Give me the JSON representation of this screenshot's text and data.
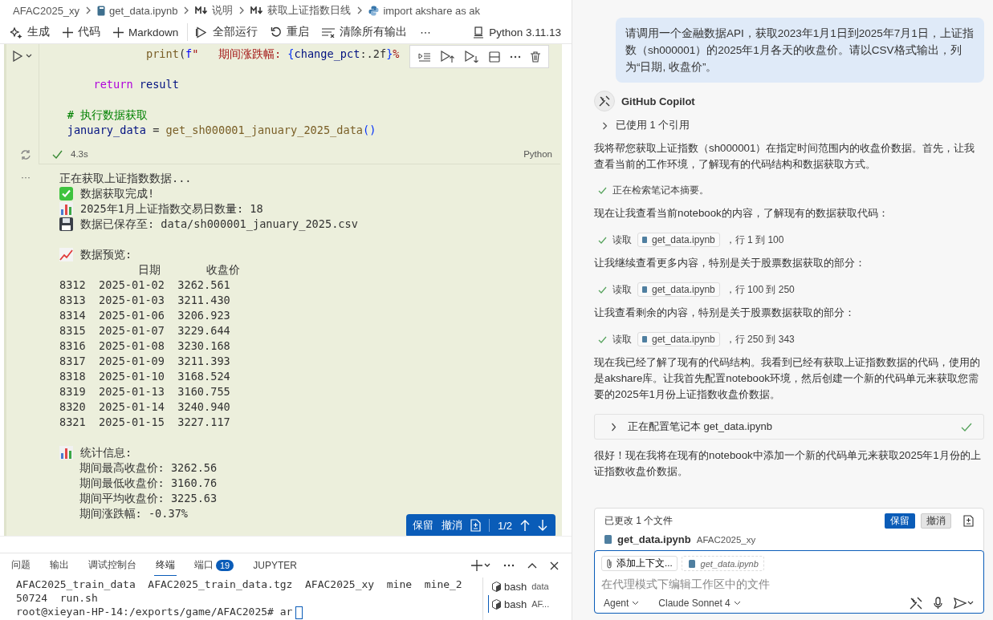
{
  "breadcrumb": [
    {
      "kind": "folder",
      "label": "AFAC2025_xy"
    },
    {
      "kind": "notebook",
      "label": "get_data.ipynb"
    },
    {
      "kind": "markdown",
      "label": "说明"
    },
    {
      "kind": "markdown",
      "label": "获取上证指数日线"
    },
    {
      "kind": "python",
      "label": "import akshare as ak"
    }
  ],
  "toolbar": [
    {
      "kind": "sparkle",
      "label": "生成"
    },
    {
      "kind": "plus",
      "label": "代码"
    },
    {
      "kind": "plus",
      "label": "Markdown"
    },
    {
      "kind": "run-all",
      "label": "全部运行"
    },
    {
      "kind": "restart",
      "label": "重启"
    },
    {
      "kind": "clear",
      "label": "清除所有输出"
    },
    {
      "kind": "more",
      "label": "⋯"
    }
  ],
  "kernel": "Python 3.11.13",
  "code_lines": [
    {
      "space_before": false,
      "tokens": [
        {
          "kind": "fn",
          "text": "                print"
        },
        {
          "kind": "punc",
          "text": "("
        },
        {
          "kind": "kw2",
          "text": "f"
        },
        {
          "kind": "str",
          "text": "\"   期间涨跌幅: "
        },
        {
          "kind": "punc2",
          "text": "{"
        },
        {
          "kind": "var",
          "text": "change_pct"
        },
        {
          "kind": "plain",
          "text": ":.2f"
        },
        {
          "kind": "punc2",
          "text": "}"
        },
        {
          "kind": "str",
          "text": "%"
        }
      ]
    },
    {
      "space_before": true,
      "tokens": [
        {
          "kind": "kw",
          "text": "        return"
        },
        {
          "kind": "var",
          "text": " result"
        }
      ]
    },
    {
      "space_before": true,
      "tokens": [
        {
          "kind": "comment",
          "text": "    # 执行数据获取"
        }
      ]
    },
    {
      "space_before": false,
      "tokens": [
        {
          "kind": "var",
          "text": "    january_data"
        },
        {
          "kind": "plain",
          "text": " = "
        },
        {
          "kind": "fn",
          "text": "get_sh000001_january_2025_data"
        },
        {
          "kind": "punc2",
          "text": "()"
        }
      ]
    }
  ],
  "cell": {
    "duration": "4.3s",
    "language": "Python",
    "succeeded": true
  },
  "output_ellipsis": "···",
  "output_lines": [
    {
      "text": "正在获取上证指数数据..."
    },
    {
      "kind": "check",
      "text": "数据获取完成!"
    },
    {
      "kind": "bars",
      "text": "2025年1月上证指数交易日数量: 18"
    },
    {
      "kind": "disk",
      "text": "数据已保存至: data/sh000001_january_2025.csv"
    },
    {
      "kind": "trend",
      "text": "数据预览:",
      "space_before": true
    },
    {
      "text": "            日期       收盘价"
    },
    {
      "text": "8312  2025-01-02  3262.561"
    },
    {
      "text": "8313  2025-01-03  3211.430"
    },
    {
      "text": "8314  2025-01-06  3206.923"
    },
    {
      "text": "8315  2025-01-07  3229.644"
    },
    {
      "text": "8316  2025-01-08  3230.168"
    },
    {
      "text": "8317  2025-01-09  3211.393"
    },
    {
      "text": "8318  2025-01-10  3168.524"
    },
    {
      "text": "8319  2025-01-13  3160.755"
    },
    {
      "text": "8320  2025-01-14  3240.940"
    },
    {
      "text": "8321  2025-01-15  3227.117"
    },
    {
      "kind": "bars",
      "text": "统计信息:",
      "space_before": true
    },
    {
      "text": "   期间最高收盘价: 3262.56"
    },
    {
      "text": "   期间最低收盘价: 3160.76"
    },
    {
      "text": "   期间平均收盘价: 3225.63"
    },
    {
      "text": "   期间涨跌幅: -0.37%"
    }
  ],
  "diff_widget": {
    "keep": "保留",
    "undo": "撤消",
    "position": "1/2"
  },
  "panel": {
    "tabs": [
      {
        "label": "问题",
        "selected": false
      },
      {
        "label": "输出",
        "selected": false
      },
      {
        "label": "调试控制台",
        "selected": false
      },
      {
        "label": "终端",
        "selected": true
      },
      {
        "label": "端口",
        "badge": "19",
        "selected": false
      },
      {
        "label": "JUPYTER",
        "selected": false
      }
    ],
    "terminal_lines": [
      "AFAC2025_train_data  AFAC2025_train_data.tgz  AFAC2025_xy  mine  mine_2",
      "50724  run.sh",
      "root@xieyan-HP-14:/exports/game/AFAC2025# ar"
    ],
    "terminals": [
      {
        "name": "bash",
        "detail": "data",
        "selected": false
      },
      {
        "name": "bash",
        "detail": "AF...",
        "selected": true
      }
    ]
  },
  "chat": {
    "user_message": "请调用一个金融数据API，获取2023年1月1日到2025年7月1日，上证指数（sh000001）的2025年1月各天的收盘价。请以CSV格式输出，列为“日期, 收盘价”。",
    "assistant": "GitHub Copilot",
    "references": "已使用 1 个引用",
    "items": [
      {
        "kind": "paragraph",
        "text": "我将帮您获取上证指数（sh000001）在指定时间范围内的收盘价数据。首先，让我查看当前的工作环境，了解现有的代码结构和数据获取方式。"
      },
      {
        "kind": "step",
        "text": "正在检索笔记本摘要。"
      },
      {
        "kind": "paragraph",
        "text": "现在让我查看当前notebook的内容，了解现有的数据获取代码："
      },
      {
        "kind": "read",
        "text": "读取",
        "file": "get_data.ipynb",
        "range": "，行 1 到 100"
      },
      {
        "kind": "paragraph",
        "text": "让我继续查看更多内容，特别是关于股票数据获取的部分："
      },
      {
        "kind": "read",
        "text": "读取",
        "file": "get_data.ipynb",
        "range": "，行 100 到 250"
      },
      {
        "kind": "paragraph",
        "text": "让我查看剩余的内容，特别是关于股票数据获取的部分："
      },
      {
        "kind": "read",
        "text": "读取",
        "file": "get_data.ipynb",
        "range": "，行 250 到 343"
      },
      {
        "kind": "paragraph",
        "text": "现在我已经了解了现有的代码结构。我看到已经有获取上证指数数据的代码，使用的是akshare库。让我首先配置notebook环境，然后创建一个新的代码单元来获取您需要的2025年1月份上证指数收盘价数据。"
      },
      {
        "kind": "task",
        "text": "正在配置笔记本 get_data.ipynb"
      },
      {
        "kind": "paragraph",
        "text": "很好！现在我将在现有的notebook中添加一个新的代码单元来获取2025年1月份的上证指数收盘价数据。"
      }
    ],
    "changes": {
      "title": "已更改 1 个文件",
      "keep": "保留",
      "undo": "撤消",
      "file": "get_data.ipynb",
      "folder": "AFAC2025_xy"
    },
    "input": {
      "attach": "添加上下文...",
      "context_file": "get_data.ipynb",
      "placeholder": "在代理模式下编辑工作区中的文件",
      "mode": "Agent",
      "model": "Claude Sonnet 4"
    }
  }
}
